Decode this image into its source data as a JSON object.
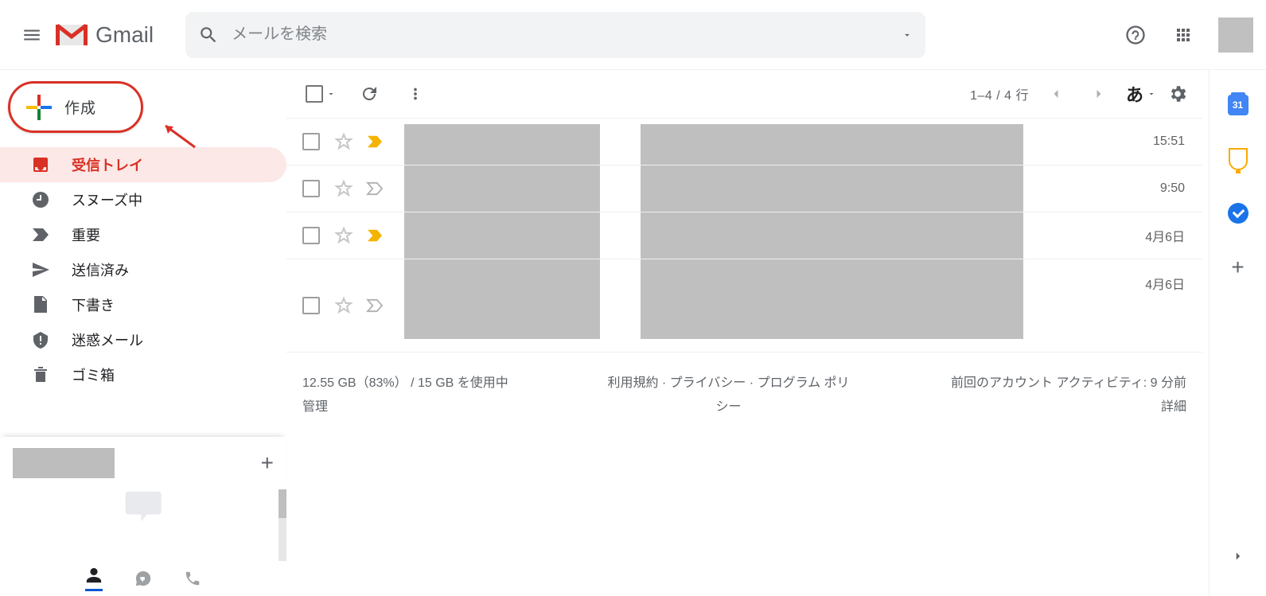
{
  "header": {
    "product": "Gmail",
    "search_placeholder": "メールを検索",
    "calendar_day": "31"
  },
  "compose": {
    "label": "作成"
  },
  "sidebar": {
    "items": [
      {
        "label": "受信トレイ"
      },
      {
        "label": "スヌーズ中"
      },
      {
        "label": "重要"
      },
      {
        "label": "送信済み"
      },
      {
        "label": "下書き"
      },
      {
        "label": "迷惑メール"
      },
      {
        "label": "ゴミ箱"
      }
    ]
  },
  "toolbar": {
    "page_count": "1–4 / 4 行",
    "ime_label": "あ"
  },
  "mails": [
    {
      "time": "15:51",
      "important": true
    },
    {
      "time": "9:50",
      "important": false
    },
    {
      "time": "4月6日",
      "important": true
    },
    {
      "time": "4月6日",
      "important": false
    }
  ],
  "footer": {
    "storage_line1": "12.55 GB（83%） / 15 GB を使用中",
    "storage_line2": "管理",
    "policy_line1": "利用規約 · プライバシー · プログラム ポリ",
    "policy_line2": "シー",
    "activity_line1": "前回のアカウント アクティビティ: 9 分前",
    "activity_line2": "詳細"
  }
}
